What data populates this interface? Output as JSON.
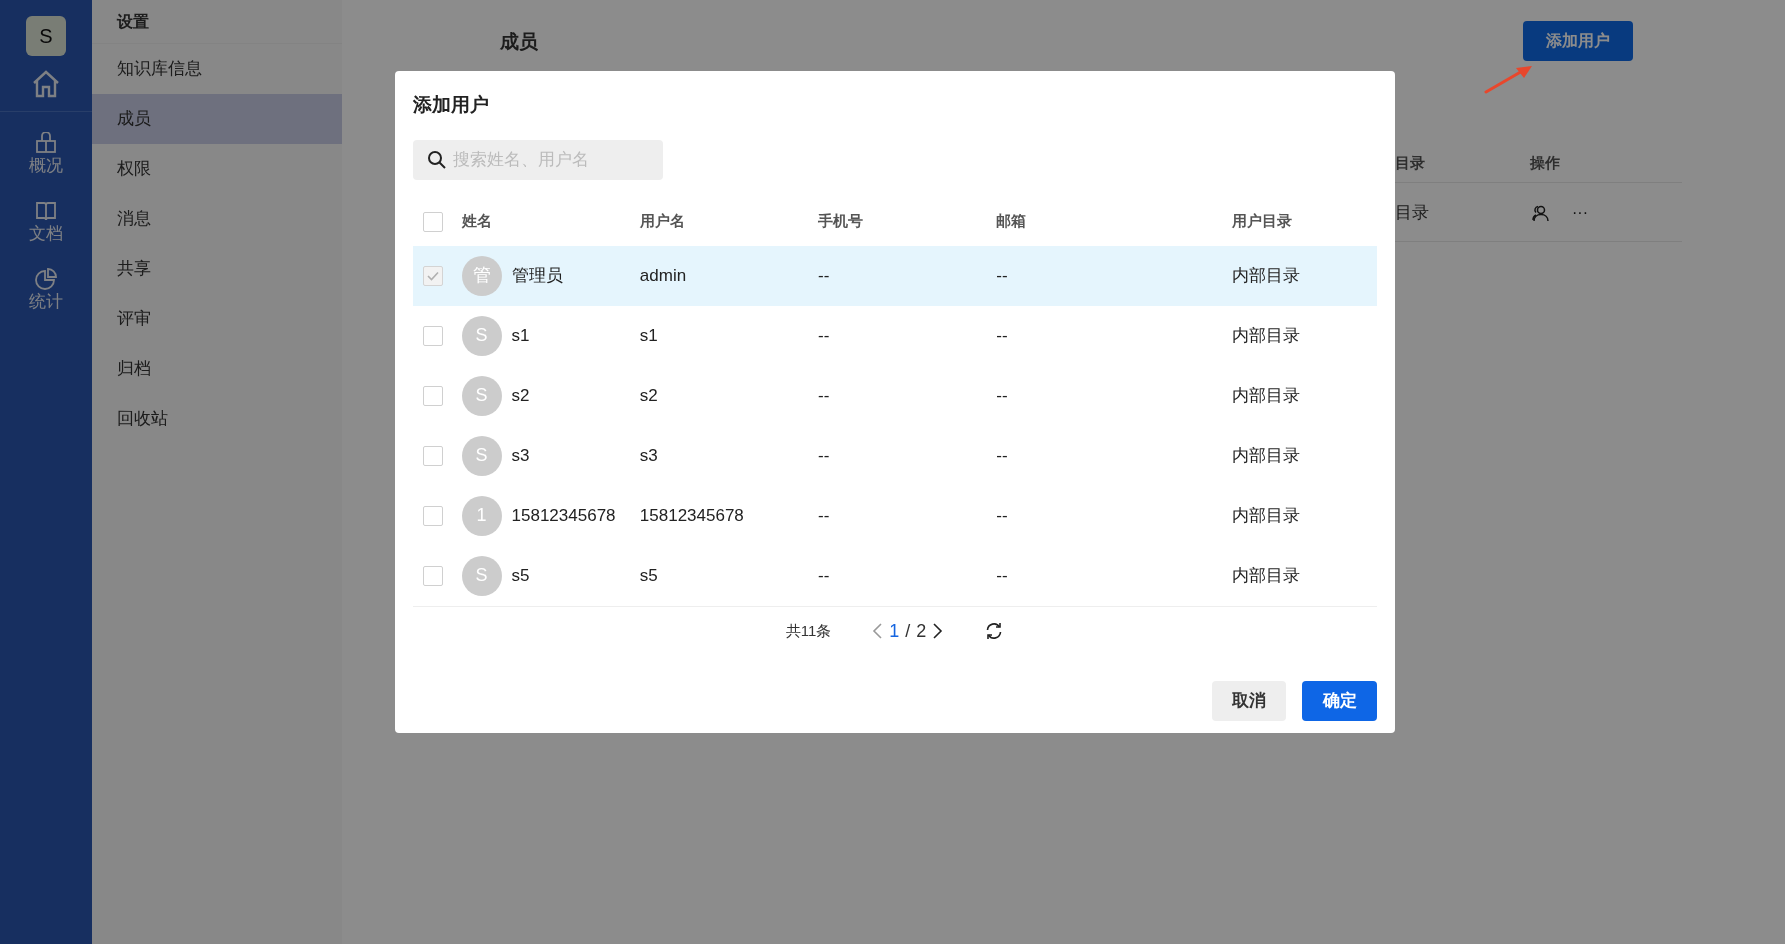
{
  "nav": {
    "avatar": "S",
    "items": [
      {
        "kind": "home"
      },
      {
        "kind": "overview",
        "label": "概况"
      },
      {
        "kind": "docs",
        "label": "文档"
      },
      {
        "kind": "stats",
        "label": "统计"
      }
    ]
  },
  "settings": {
    "title": "设置",
    "items": [
      {
        "label": "知识库信息",
        "selected": false
      },
      {
        "label": "成员",
        "selected": true
      },
      {
        "label": "权限",
        "selected": false
      },
      {
        "label": "消息",
        "selected": false
      },
      {
        "label": "共享",
        "selected": false
      },
      {
        "label": "评审",
        "selected": false
      },
      {
        "label": "归档",
        "selected": false
      },
      {
        "label": "回收站",
        "selected": false
      }
    ]
  },
  "page": {
    "title": "成员",
    "add_button": "添加用户",
    "table": {
      "columns": [
        "目录",
        "操作"
      ],
      "rows": [
        {
          "directory": "目录",
          "more": "···"
        }
      ]
    }
  },
  "modal": {
    "title": "添加用户",
    "search": {
      "placeholder": "搜索姓名、用户名"
    },
    "select_all": {
      "checked": false
    },
    "columns": [
      "姓名",
      "用户名",
      "手机号",
      "邮箱",
      "用户目录"
    ],
    "rows": [
      {
        "avatar": "管",
        "name": "管理员",
        "username": "admin",
        "phone": "--",
        "email": "--",
        "directory": "内部目录",
        "checked": true
      },
      {
        "avatar": "S",
        "name": "s1",
        "username": "s1",
        "phone": "--",
        "email": "--",
        "directory": "内部目录",
        "checked": false
      },
      {
        "avatar": "S",
        "name": "s2",
        "username": "s2",
        "phone": "--",
        "email": "--",
        "directory": "内部目录",
        "checked": false
      },
      {
        "avatar": "S",
        "name": "s3",
        "username": "s3",
        "phone": "--",
        "email": "--",
        "directory": "内部目录",
        "checked": false
      },
      {
        "avatar": "1",
        "name": "15812345678",
        "username": "15812345678",
        "phone": "--",
        "email": "--",
        "directory": "内部目录",
        "checked": false
      },
      {
        "avatar": "S",
        "name": "s5",
        "username": "s5",
        "phone": "--",
        "email": "--",
        "directory": "内部目录",
        "checked": false
      }
    ],
    "pagination": {
      "total": "共11条",
      "current": "1",
      "separator": "/",
      "pages": "2"
    },
    "buttons": [
      {
        "kind": "cancel",
        "label": "取消"
      },
      {
        "kind": "confirm",
        "label": "确定"
      }
    ]
  }
}
